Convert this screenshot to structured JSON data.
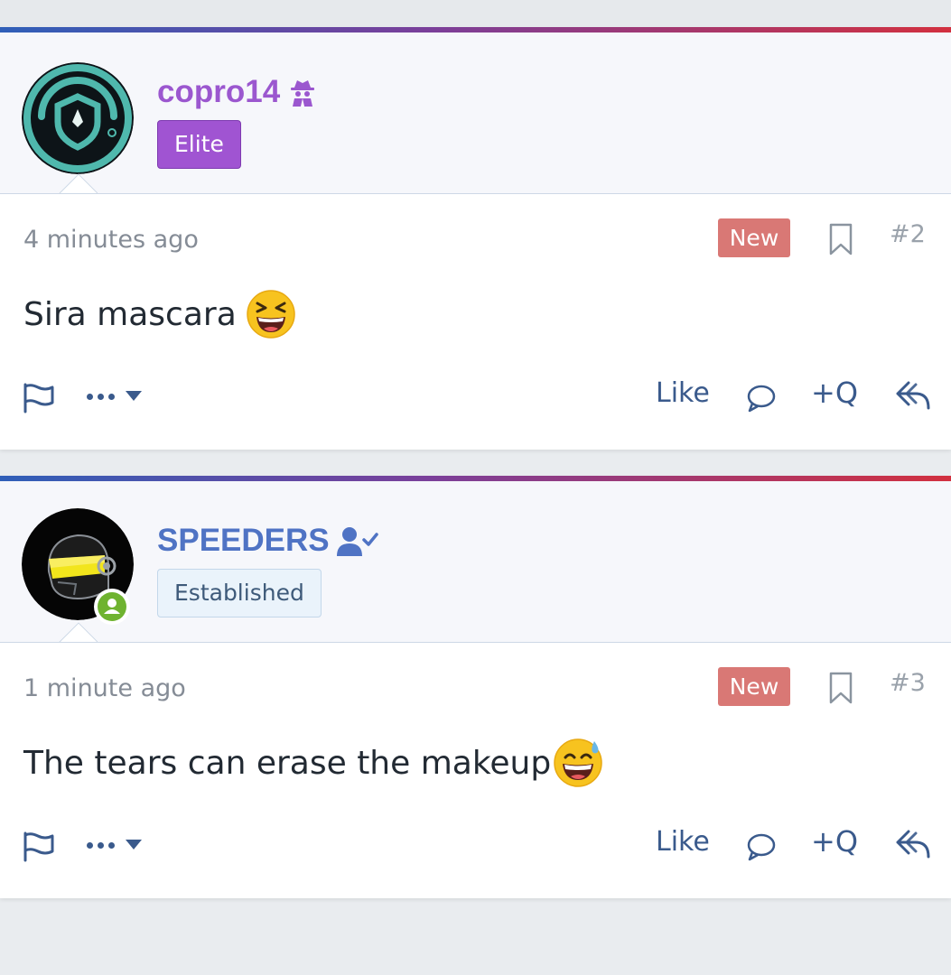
{
  "posts": [
    {
      "username": "copro14",
      "username_color": "#9b57cf",
      "username_icon": "user-secret-icon",
      "rank": "Elite",
      "time": "4 minutes ago",
      "new_label": "New",
      "post_number": "#2",
      "message": "Sira mascara",
      "emoji": "laughing-squinting-face-emoji",
      "actions": {
        "like": "Like",
        "multiquote": "+Q"
      }
    },
    {
      "username": "SPEEDERS",
      "username_color": "#4f73c4",
      "username_icon": "user-check-icon",
      "rank": "Established",
      "time": "1 minute ago",
      "new_label": "New",
      "post_number": "#3",
      "message": "The tears can erase the makeup",
      "emoji": "grinning-face-with-sweat-emoji",
      "actions": {
        "like": "Like",
        "multiquote": "+Q"
      }
    }
  ],
  "colors": {
    "accent_gradient": [
      "#2f5fb8",
      "#7a3f9a",
      "#d2303f"
    ],
    "new_badge": "#d97875",
    "elite_badge": "#a054d2",
    "action_blue": "#3a5a8c"
  }
}
